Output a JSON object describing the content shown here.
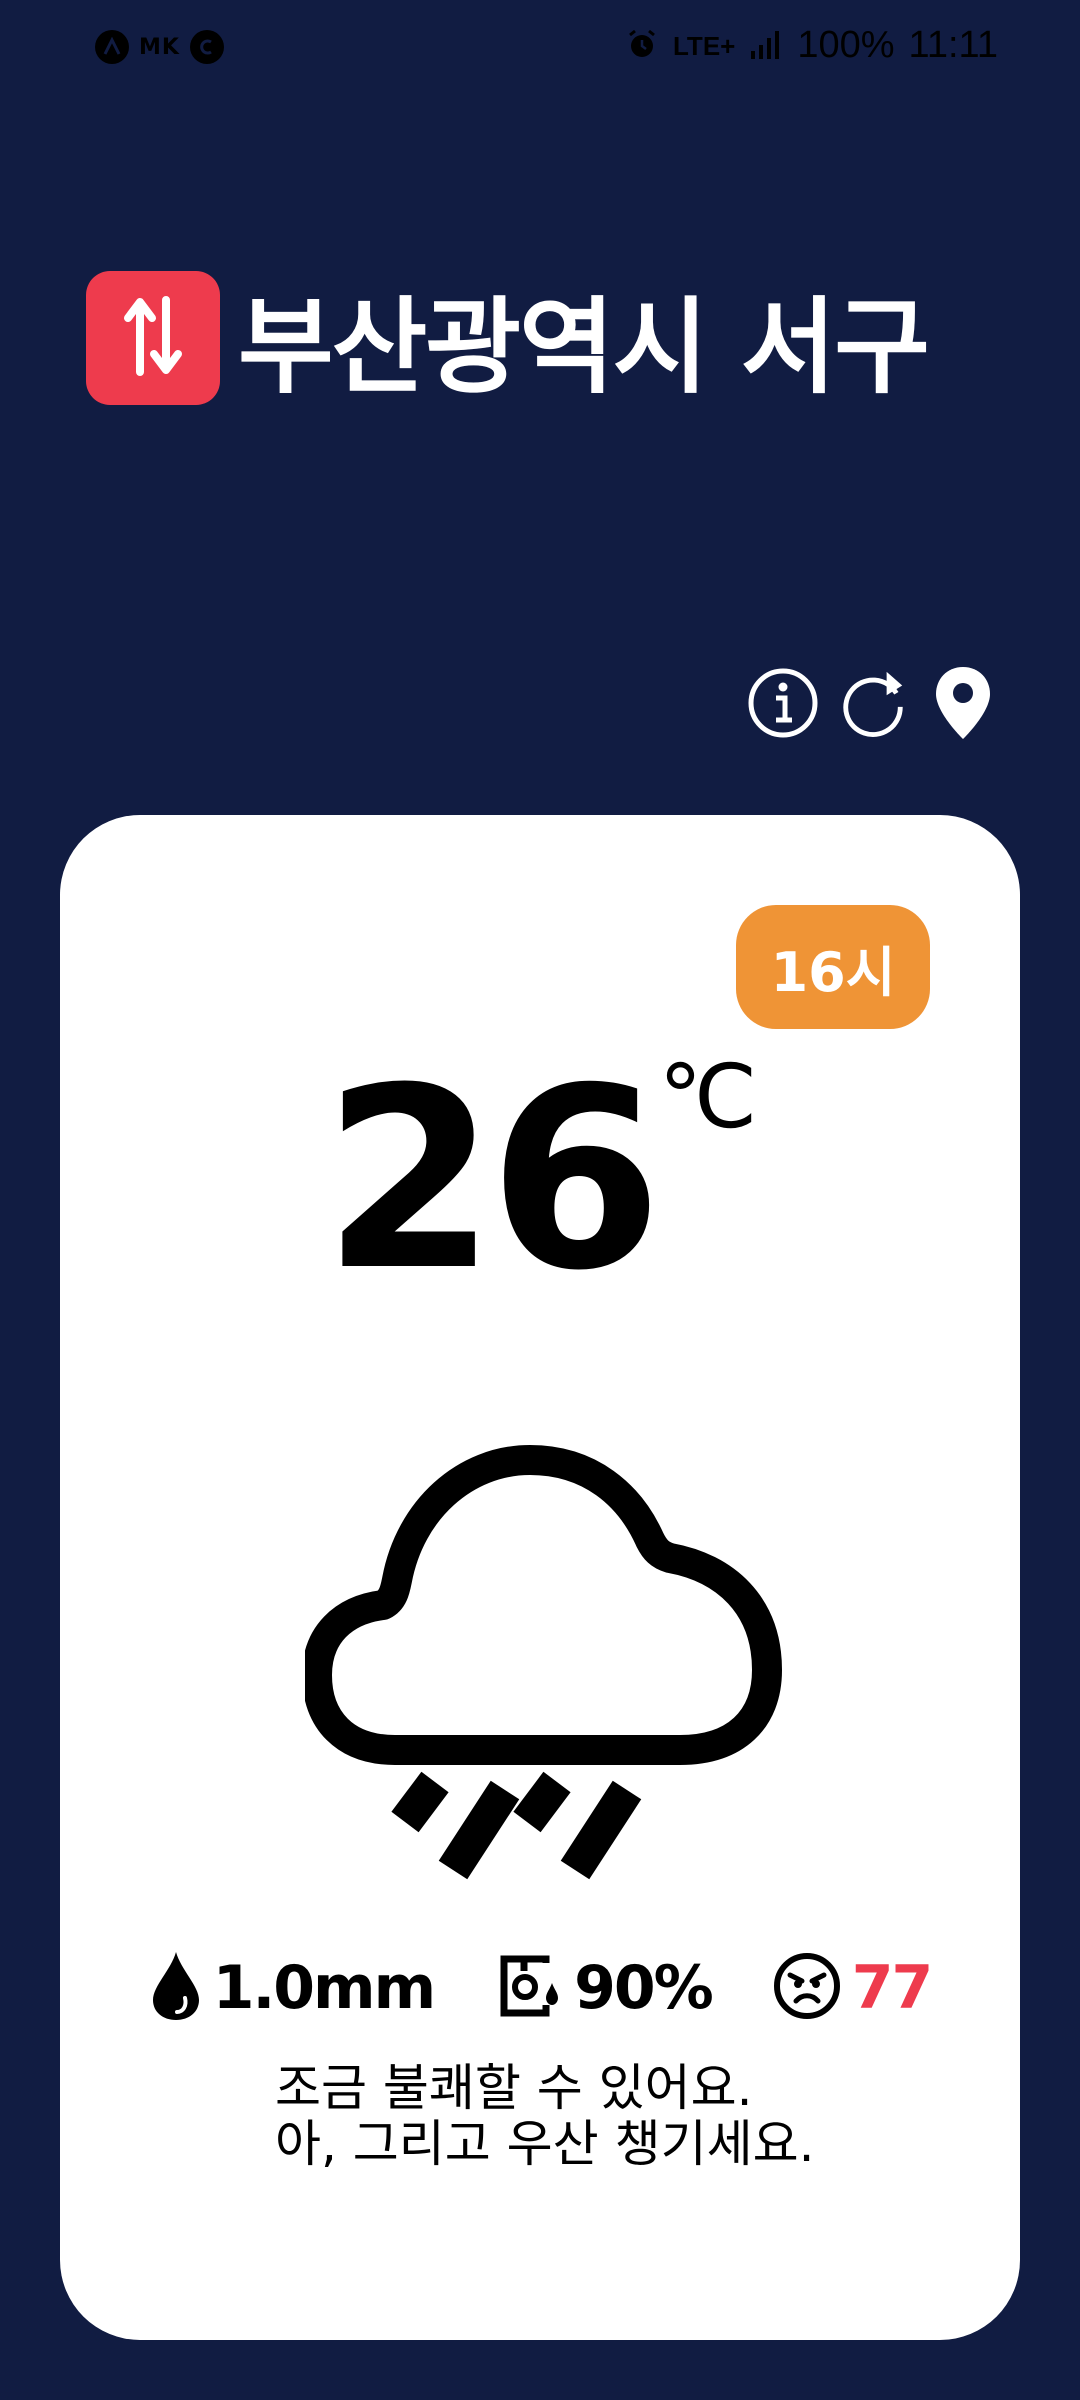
{
  "status_bar": {
    "left_icons": [
      "a-circle-icon",
      "mk-label",
      "c-circle-icon"
    ],
    "mk_label": "MK",
    "network": "LTE+",
    "battery": "100%",
    "time": "11:11"
  },
  "header": {
    "location": "부산광역시 서구",
    "swap_icon": "swap-vertical-icon",
    "swap_color": "#ee3b4d"
  },
  "actions": [
    {
      "icon": "info-icon"
    },
    {
      "icon": "refresh-icon"
    },
    {
      "icon": "location-pin-icon"
    }
  ],
  "card": {
    "hour_badge": "16시",
    "badge_color": "#ef9436",
    "temperature": "26",
    "temperature_unit": "℃",
    "weather_icon": "cloud-rain-icon",
    "metrics": {
      "precipitation": "1.0mm",
      "humidity": "90%",
      "discomfort_index": "77",
      "discomfort_color": "#ee3b4d"
    },
    "message_line1": "조금 불쾌할 수 있어요.",
    "message_line2": "아, 그리고 우산 챙기세요."
  },
  "colors": {
    "background": "#111c42",
    "card": "#ffffff"
  }
}
